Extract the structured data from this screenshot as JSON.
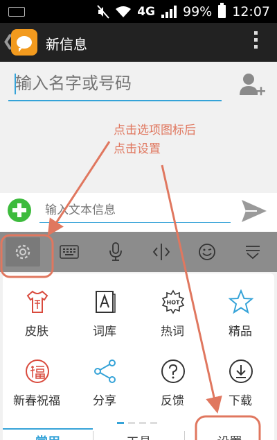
{
  "status_bar": {
    "network": "4G",
    "battery": "99%",
    "time": "12:07"
  },
  "app_bar": {
    "title": "新信息"
  },
  "recipient": {
    "placeholder": "输入名字或号码"
  },
  "annotation": {
    "line1": "点击选项图标后",
    "line2": "点击设置"
  },
  "compose": {
    "placeholder": "输入文本信息"
  },
  "keyboard_toolbar": {
    "items": [
      "settings-icon",
      "keyboard-icon",
      "microphone-icon",
      "cursor-icon",
      "emoji-icon",
      "collapse-icon"
    ]
  },
  "panel": {
    "items": [
      {
        "label": "皮肤",
        "icon": "shirt-icon"
      },
      {
        "label": "词库",
        "icon": "dictionary-icon"
      },
      {
        "label": "热词",
        "icon": "hot-icon"
      },
      {
        "label": "精品",
        "icon": "star-icon"
      },
      {
        "label": "新春祝福",
        "icon": "blessing-icon"
      },
      {
        "label": "分享",
        "icon": "share-icon"
      },
      {
        "label": "反馈",
        "icon": "feedback-icon"
      },
      {
        "label": "下载",
        "icon": "download-icon"
      }
    ],
    "tabs": [
      {
        "label": "常用"
      },
      {
        "label": "工具"
      },
      {
        "label": "设置"
      }
    ]
  },
  "colors": {
    "accent": "#35a3d8",
    "annotation": "#e0775f",
    "red_icon": "#d94a3d"
  }
}
